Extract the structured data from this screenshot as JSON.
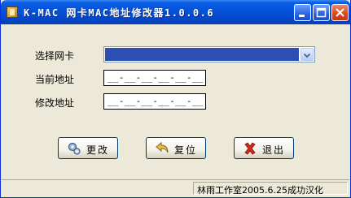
{
  "window": {
    "title": "K-MAC 网卡MAC地址修改器1.0.0.6"
  },
  "form": {
    "nic_label": "选择网卡",
    "current_label": "当前地址",
    "modify_label": "修改地址",
    "current_mask": "__-__-__-__-__-__",
    "modify_mask": "__-__-__-__-__-__"
  },
  "buttons": {
    "change": "更改",
    "reset": "复位",
    "exit": "退出"
  },
  "status": {
    "text": "林雨工作室2005.6.25成功汉化"
  }
}
